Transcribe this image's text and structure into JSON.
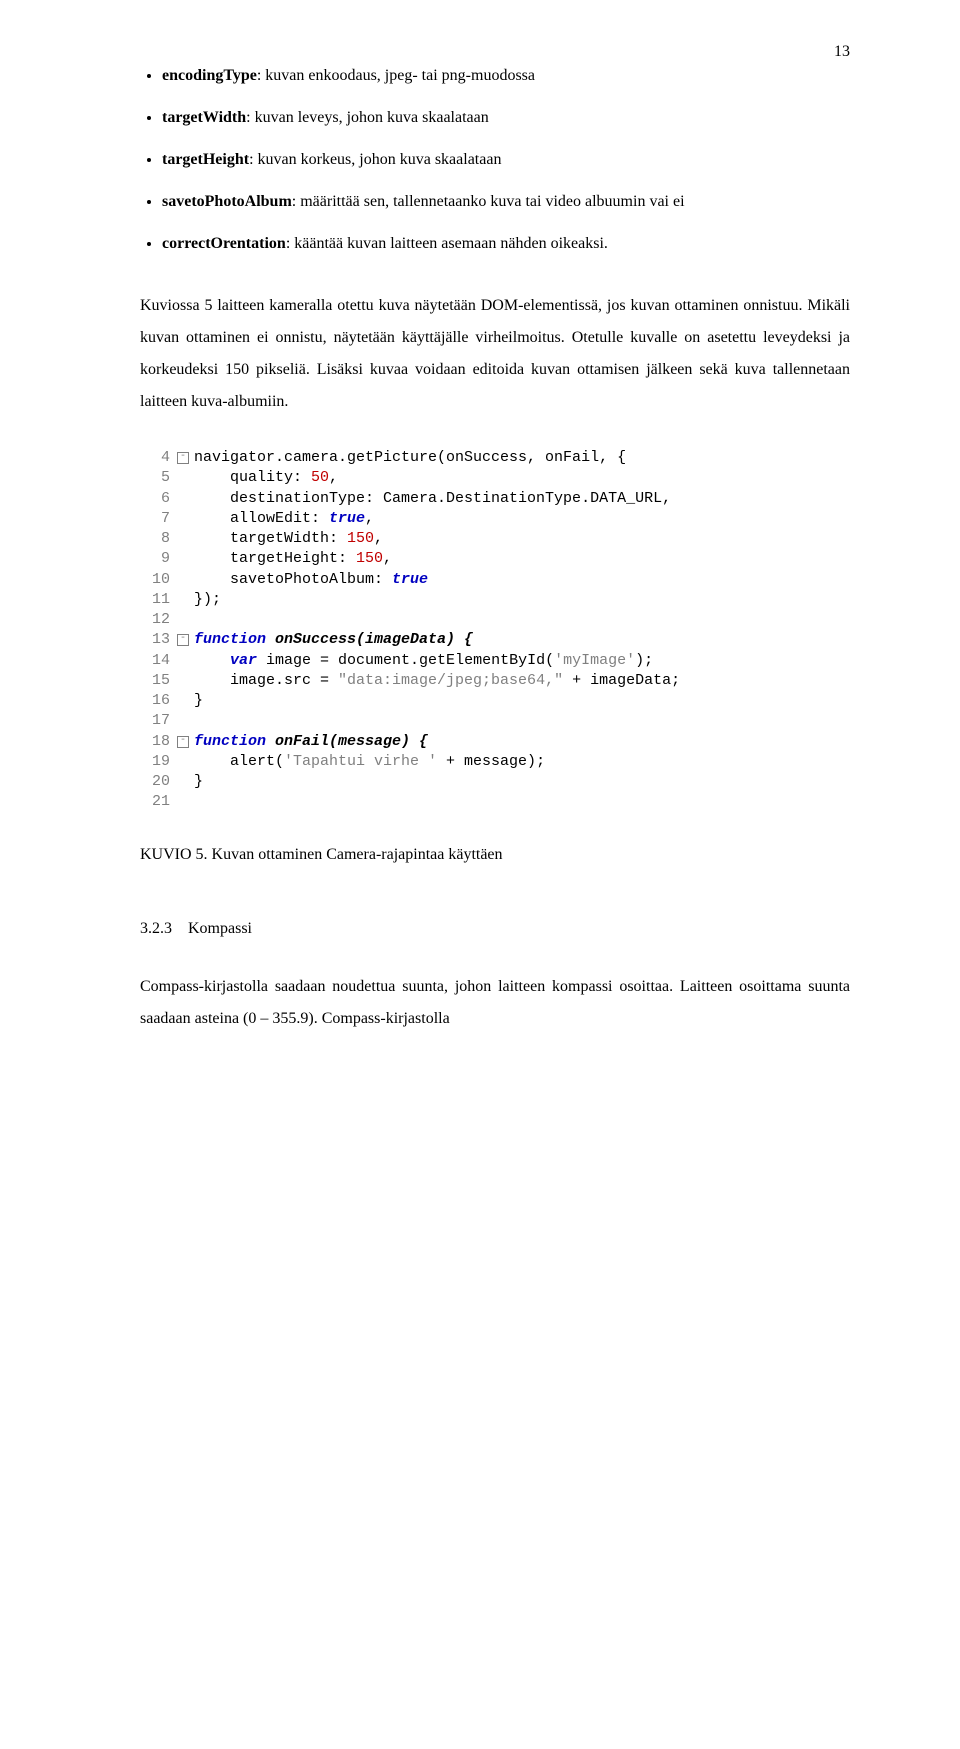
{
  "page_number": "13",
  "bullets": [
    {
      "term": "encodingType",
      "desc": ": kuvan enkoodaus, jpeg- tai png-muodossa"
    },
    {
      "term": "targetWidth",
      "desc": ": kuvan leveys, johon kuva skaalataan"
    },
    {
      "term": "targetHeight",
      "desc": ": kuvan korkeus, johon kuva skaalataan"
    },
    {
      "term": "savetoPhotoAlbum",
      "desc": ": määrittää sen, tallennetaanko kuva tai video albuumin vai ei"
    },
    {
      "term": "correctOrentation",
      "desc": ": kääntää kuvan laitteen asemaan nähden oikeaksi."
    }
  ],
  "paragraph1": "Kuviossa 5 laitteen kameralla otettu kuva näytetään DOM-elementissä, jos kuvan ottaminen onnistuu. Mikäli kuvan ottaminen ei onnistu, näytetään käyttäjälle virheilmoitus. Otetulle kuvalle on asetettu leveydeksi ja korkeudeksi 150 pikseliä. Lisäksi kuvaa voidaan editoida kuvan ottamisen jälkeen sekä kuva tallennetaan laitteen kuva-albumiin.",
  "code": {
    "lines": [
      {
        "n": "4",
        "fold": "open",
        "tokens": [
          {
            "t": "navigator.camera.getPicture(onSuccess, onFail, {",
            "c": "plain"
          }
        ]
      },
      {
        "n": "5",
        "fold": "line",
        "tokens": [
          {
            "t": "    quality: ",
            "c": "plain"
          },
          {
            "t": "50",
            "c": "num"
          },
          {
            "t": ",",
            "c": "plain"
          }
        ]
      },
      {
        "n": "6",
        "fold": "line",
        "tokens": [
          {
            "t": "    destinationType: Camera.DestinationType.DATA_URL,",
            "c": "plain"
          }
        ]
      },
      {
        "n": "7",
        "fold": "line",
        "tokens": [
          {
            "t": "    allowEdit: ",
            "c": "plain"
          },
          {
            "t": "true",
            "c": "kw"
          },
          {
            "t": ",",
            "c": "plain"
          }
        ]
      },
      {
        "n": "8",
        "fold": "line",
        "tokens": [
          {
            "t": "    targetWidth: ",
            "c": "plain"
          },
          {
            "t": "150",
            "c": "num"
          },
          {
            "t": ",",
            "c": "plain"
          }
        ]
      },
      {
        "n": "9",
        "fold": "line",
        "tokens": [
          {
            "t": "    targetHeight: ",
            "c": "plain"
          },
          {
            "t": "150",
            "c": "num"
          },
          {
            "t": ",",
            "c": "plain"
          }
        ]
      },
      {
        "n": "10",
        "fold": "line",
        "tokens": [
          {
            "t": "    savetoPhotoAlbum: ",
            "c": "plain"
          },
          {
            "t": "true",
            "c": "kw"
          }
        ]
      },
      {
        "n": "11",
        "fold": "close",
        "tokens": [
          {
            "t": "});",
            "c": "plain"
          }
        ]
      },
      {
        "n": "12",
        "fold": "none",
        "tokens": [
          {
            "t": "",
            "c": "plain"
          }
        ]
      },
      {
        "n": "13",
        "fold": "open",
        "tokens": [
          {
            "t": "function",
            "c": "kw"
          },
          {
            "t": " onSuccess(imageData) {",
            "c": "kw2"
          }
        ]
      },
      {
        "n": "14",
        "fold": "line",
        "tokens": [
          {
            "t": "    ",
            "c": "plain"
          },
          {
            "t": "var",
            "c": "kw"
          },
          {
            "t": " image = document.getElementById(",
            "c": "plain"
          },
          {
            "t": "'myImage'",
            "c": "str"
          },
          {
            "t": ");",
            "c": "plain"
          }
        ]
      },
      {
        "n": "15",
        "fold": "line",
        "tokens": [
          {
            "t": "    image.src = ",
            "c": "plain"
          },
          {
            "t": "\"data:image/jpeg;base64,\"",
            "c": "str"
          },
          {
            "t": " + imageData;",
            "c": "plain"
          }
        ]
      },
      {
        "n": "16",
        "fold": "close",
        "tokens": [
          {
            "t": "}",
            "c": "plain"
          }
        ]
      },
      {
        "n": "17",
        "fold": "none",
        "tokens": [
          {
            "t": "",
            "c": "plain"
          }
        ]
      },
      {
        "n": "18",
        "fold": "open",
        "tokens": [
          {
            "t": "function",
            "c": "kw"
          },
          {
            "t": " onFail(message) {",
            "c": "kw2"
          }
        ]
      },
      {
        "n": "19",
        "fold": "line",
        "tokens": [
          {
            "t": "    alert(",
            "c": "plain"
          },
          {
            "t": "'Tapahtui virhe '",
            "c": "str"
          },
          {
            "t": " + message);",
            "c": "plain"
          }
        ]
      },
      {
        "n": "20",
        "fold": "close",
        "tokens": [
          {
            "t": "}",
            "c": "plain"
          }
        ]
      },
      {
        "n": "21",
        "fold": "none",
        "tokens": [
          {
            "t": "",
            "c": "plain"
          }
        ]
      }
    ]
  },
  "caption": "KUVIO 5. Kuvan ottaminen Camera-rajapintaa käyttäen",
  "section_number": "3.2.3",
  "section_title": "Kompassi",
  "paragraph2": "Compass-kirjastolla saadaan noudettua suunta, johon laitteen kompassi osoittaa. Laitteen osoittama suunta saadaan asteina (0 – 355.9). Compass-kirjastolla"
}
